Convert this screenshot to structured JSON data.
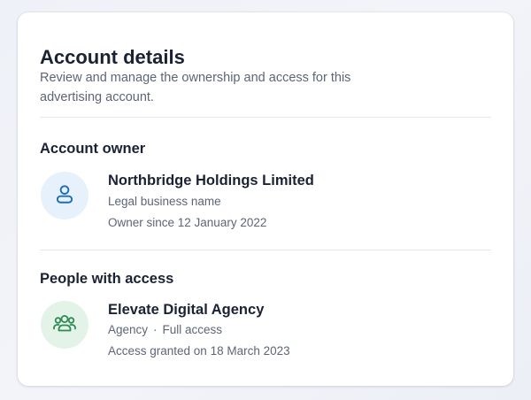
{
  "card": {
    "title": "Account details",
    "subtitle": "Review and manage the ownership and access for this advertising account."
  },
  "owner_section": {
    "title": "Account owner",
    "icon": "user-icon",
    "name": "Northbridge Holdings Limited",
    "type": "Legal business name",
    "since": "Owner since 12 January 2022"
  },
  "access_section": {
    "title": "People with access",
    "icon": "users-group-icon",
    "name": "Elevate Digital Agency",
    "role": "Agency",
    "separator": "·",
    "access_level": "Full access",
    "granted": "Access granted on 18 March 2023"
  },
  "colors": {
    "owner_icon": "#1f6fb5",
    "owner_icon_bg": "#e6f1fb",
    "access_icon": "#2e8a54",
    "access_icon_bg": "#e3f3e8"
  }
}
